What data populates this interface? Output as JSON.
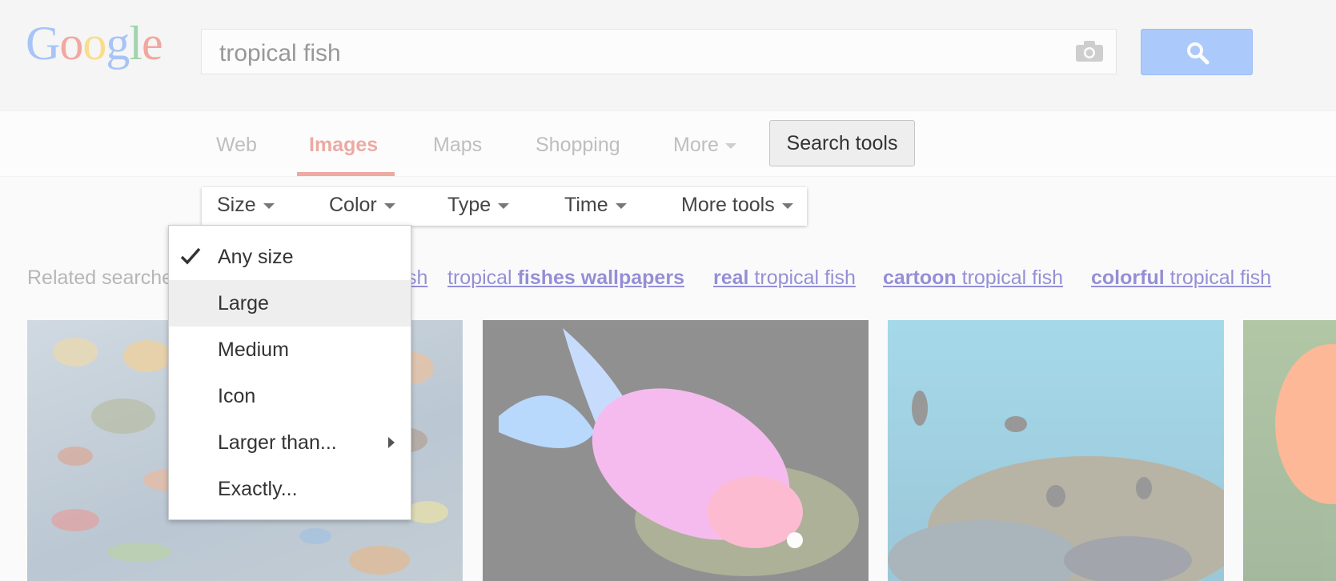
{
  "header": {
    "logo_letters": [
      "G",
      "o",
      "o",
      "g",
      "l",
      "e"
    ],
    "search_query": "tropical fish",
    "camera_icon": "camera-icon",
    "search_icon": "magnifier-icon"
  },
  "nav": {
    "tabs": [
      {
        "label": "Web",
        "active": false
      },
      {
        "label": "Images",
        "active": true
      },
      {
        "label": "Maps",
        "active": false
      },
      {
        "label": "Shopping",
        "active": false
      },
      {
        "label": "More",
        "active": false
      }
    ],
    "search_tools_label": "Search tools"
  },
  "tools": {
    "items": [
      "Size",
      "Color",
      "Type",
      "Time",
      "More tools"
    ]
  },
  "size_menu": {
    "items": [
      {
        "label": "Any size",
        "checked": true
      },
      {
        "label": "Large",
        "hovered": true
      },
      {
        "label": "Medium"
      },
      {
        "label": "Icon"
      },
      {
        "label": "Larger than...",
        "submenu": true
      },
      {
        "label": "Exactly..."
      }
    ]
  },
  "related": {
    "label": "Related searches:",
    "partial_link": "sh",
    "links": [
      {
        "pre": "tropical ",
        "bold": "fishes wallpapers",
        "post": ""
      },
      {
        "pre": "",
        "bold": "real",
        "post": " tropical fish"
      },
      {
        "pre": "",
        "bold": "cartoon",
        "post": " tropical fish"
      },
      {
        "pre": "",
        "bold": "colorful",
        "post": " tropical fish"
      }
    ]
  },
  "colors": {
    "google_red": "#dd4b39",
    "search_blue": "#4d90fe",
    "link_blue": "#1a0dab"
  }
}
